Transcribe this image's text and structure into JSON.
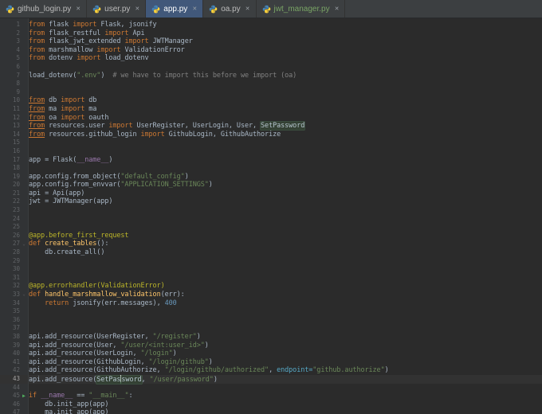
{
  "palette": {
    "editor_bg": "#2b2b2b",
    "gutter_bg": "#313335",
    "tabbar_bg": "#3c3f41",
    "active_tab_bg": "#41587a",
    "vcs_new_file": "#79a465",
    "keyword": "#cc7832",
    "string": "#6a8759",
    "comment": "#808080",
    "decorator": "#bbb529",
    "function_name": "#ffc66b",
    "number": "#6897bb",
    "keyword_argument": "#56a8c5",
    "dunder": "#9876aa",
    "default_text": "#a9b7c6",
    "line_number": "#606366",
    "occurrence_highlight_bg": "#344134",
    "run_icon_green": "#4fa95c"
  },
  "icons": {
    "close": "✕",
    "run": "▶",
    "fold": "⌄",
    "python": "python-logo"
  },
  "tab_bar": {
    "tabs": [
      {
        "label": "github_login.py"
      },
      {
        "label": "user.py"
      },
      {
        "label": "app.py",
        "active": true
      },
      {
        "label": "oa.py"
      },
      {
        "label": "jwt_manager.py",
        "vcs_new": true
      }
    ]
  },
  "editor": {
    "lines": [
      {
        "n": 1,
        "tk": [
          [
            "kw",
            "from"
          ],
          [
            "t",
            " flask "
          ],
          [
            "kw",
            "import"
          ],
          [
            "t",
            " Flask, jsonify"
          ]
        ]
      },
      {
        "n": 2,
        "tk": [
          [
            "kw",
            "from"
          ],
          [
            "t",
            " flask_restful "
          ],
          [
            "kw",
            "import"
          ],
          [
            "t",
            " Api"
          ]
        ]
      },
      {
        "n": 3,
        "tk": [
          [
            "kw",
            "from"
          ],
          [
            "t",
            " flask_jwt_extended "
          ],
          [
            "kw",
            "import"
          ],
          [
            "t",
            " JWTManager"
          ]
        ]
      },
      {
        "n": 4,
        "tk": [
          [
            "kw",
            "from"
          ],
          [
            "t",
            " marshmallow "
          ],
          [
            "kw",
            "import"
          ],
          [
            "t",
            " ValidationError"
          ]
        ]
      },
      {
        "n": 5,
        "tk": [
          [
            "kw",
            "from"
          ],
          [
            "t",
            " dotenv "
          ],
          [
            "kw",
            "import"
          ],
          [
            "t",
            " load_dotenv"
          ]
        ]
      },
      {
        "n": 6,
        "tk": []
      },
      {
        "n": 7,
        "tk": [
          [
            "t",
            "load_dotenv("
          ],
          [
            "s",
            "\".env\""
          ],
          [
            "t",
            ")  "
          ],
          [
            "c",
            "# we have to import this before we import (oa)"
          ]
        ]
      },
      {
        "n": 8,
        "tk": []
      },
      {
        "n": 9,
        "tk": []
      },
      {
        "n": 10,
        "tk": [
          [
            "kwu",
            "from"
          ],
          [
            "t",
            " db "
          ],
          [
            "kw",
            "import"
          ],
          [
            "t",
            " db"
          ]
        ]
      },
      {
        "n": 11,
        "tk": [
          [
            "kwu",
            "from"
          ],
          [
            "t",
            " ma "
          ],
          [
            "kw",
            "import"
          ],
          [
            "t",
            " ma"
          ]
        ]
      },
      {
        "n": 12,
        "tk": [
          [
            "kwu",
            "from"
          ],
          [
            "t",
            " oa "
          ],
          [
            "kw",
            "import"
          ],
          [
            "t",
            " oauth"
          ]
        ]
      },
      {
        "n": 13,
        "tk": [
          [
            "kwu",
            "from"
          ],
          [
            "t",
            " resources.user "
          ],
          [
            "kw",
            "import"
          ],
          [
            "t",
            " UserRegister, UserLogin, User, "
          ],
          [
            "hl",
            "SetPassword"
          ]
        ]
      },
      {
        "n": 14,
        "tk": [
          [
            "kwu",
            "from"
          ],
          [
            "t",
            " resources.github_login "
          ],
          [
            "kw",
            "import"
          ],
          [
            "t",
            " GithubLogin, GithubAuthorize"
          ]
        ]
      },
      {
        "n": 15,
        "tk": []
      },
      {
        "n": 16,
        "tk": []
      },
      {
        "n": 17,
        "tk": [
          [
            "t",
            "app = Flask("
          ],
          [
            "dn",
            "__name__"
          ],
          [
            "t",
            ")"
          ]
        ]
      },
      {
        "n": 18,
        "tk": []
      },
      {
        "n": 19,
        "tk": [
          [
            "t",
            "app.config.from_object("
          ],
          [
            "s",
            "\"default_config\""
          ],
          [
            "t",
            ")"
          ]
        ]
      },
      {
        "n": 20,
        "tk": [
          [
            "t",
            "app.config.from_envvar("
          ],
          [
            "s",
            "\"APPLICATION_SETTINGS\""
          ],
          [
            "t",
            ")"
          ]
        ]
      },
      {
        "n": 21,
        "tk": [
          [
            "t",
            "api = Api(app)"
          ]
        ]
      },
      {
        "n": 22,
        "tk": [
          [
            "t",
            "jwt = JWTManager(app)"
          ]
        ]
      },
      {
        "n": 23,
        "tk": []
      },
      {
        "n": 24,
        "tk": []
      },
      {
        "n": 25,
        "tk": []
      },
      {
        "n": 26,
        "tk": [
          [
            "dec",
            "@app.before_first_request"
          ]
        ]
      },
      {
        "n": 27,
        "gutter": "fold",
        "tk": [
          [
            "kw",
            "def "
          ],
          [
            "fn",
            "create_tables"
          ],
          [
            "t",
            "():"
          ]
        ]
      },
      {
        "n": 28,
        "tk": [
          [
            "t",
            "    db.create_all()"
          ]
        ]
      },
      {
        "n": 29,
        "tk": []
      },
      {
        "n": 30,
        "tk": []
      },
      {
        "n": 31,
        "tk": []
      },
      {
        "n": 32,
        "tk": [
          [
            "dec",
            "@app.errorhandler(ValidationError)"
          ]
        ]
      },
      {
        "n": 33,
        "gutter": "fold",
        "tk": [
          [
            "kw",
            "def "
          ],
          [
            "fn",
            "handle_marshmallow_validation"
          ],
          [
            "t",
            "(err):"
          ]
        ]
      },
      {
        "n": 34,
        "tk": [
          [
            "t",
            "    "
          ],
          [
            "kw",
            "return"
          ],
          [
            "t",
            " jsonify(err.messages), "
          ],
          [
            "num",
            "400"
          ]
        ]
      },
      {
        "n": 35,
        "tk": []
      },
      {
        "n": 36,
        "tk": []
      },
      {
        "n": 37,
        "tk": []
      },
      {
        "n": 38,
        "tk": [
          [
            "t",
            "api.add_resource(UserRegister, "
          ],
          [
            "s",
            "\"/register\""
          ],
          [
            "t",
            ")"
          ]
        ]
      },
      {
        "n": 39,
        "tk": [
          [
            "t",
            "api.add_resource(User, "
          ],
          [
            "s",
            "\"/user/<int:user_id>\""
          ],
          [
            "t",
            ")"
          ]
        ]
      },
      {
        "n": 40,
        "tk": [
          [
            "t",
            "api.add_resource(UserLogin, "
          ],
          [
            "s",
            "\"/login\""
          ],
          [
            "t",
            ")"
          ]
        ]
      },
      {
        "n": 41,
        "tk": [
          [
            "t",
            "api.add_resource(GithubLogin, "
          ],
          [
            "s",
            "\"/login/github\""
          ],
          [
            "t",
            ")"
          ]
        ]
      },
      {
        "n": 42,
        "tk": [
          [
            "t",
            "api.add_resource(GithubAuthorize, "
          ],
          [
            "s",
            "\"/login/github/authorized\""
          ],
          [
            "t",
            ", "
          ],
          [
            "ka",
            "endpoint="
          ],
          [
            "s",
            "\"github.authorize\""
          ],
          [
            "t",
            ")"
          ]
        ]
      },
      {
        "n": 43,
        "cur": true,
        "tk": [
          [
            "t",
            "api.add_resource("
          ],
          [
            "hl",
            "SetPas"
          ],
          [
            "caret",
            ""
          ],
          [
            "hl",
            "sword"
          ],
          [
            "t",
            ", "
          ],
          [
            "s",
            "\"/user/password\""
          ],
          [
            "t",
            ")"
          ]
        ]
      },
      {
        "n": 44,
        "tk": []
      },
      {
        "n": 45,
        "gutter": "run",
        "tk": [
          [
            "kw",
            "if"
          ],
          [
            "t",
            " "
          ],
          [
            "dn",
            "__name__"
          ],
          [
            "t",
            " == "
          ],
          [
            "s",
            "\"__main__\""
          ],
          [
            "t",
            ":"
          ]
        ]
      },
      {
        "n": 46,
        "tk": [
          [
            "t",
            "    db.init_app(app)"
          ]
        ]
      },
      {
        "n": 47,
        "tk": [
          [
            "t",
            "    ma.init_app(app)"
          ]
        ]
      }
    ]
  }
}
